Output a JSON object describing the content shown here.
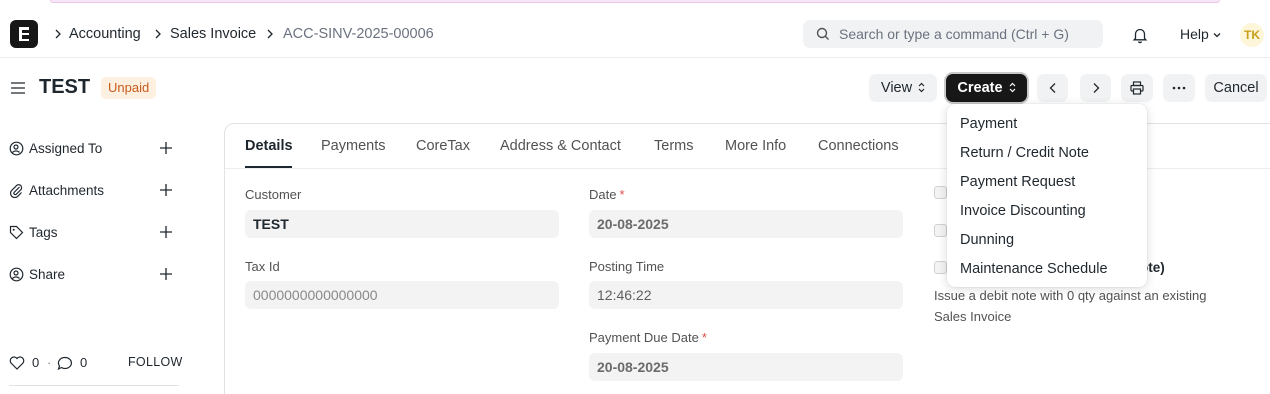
{
  "navbar": {
    "breadcrumbs": [
      "Accounting",
      "Sales Invoice",
      "ACC-SINV-2025-00006"
    ],
    "search_placeholder": "Search or type a command (Ctrl + G)",
    "help_label": "Help",
    "avatar_initials": "TK"
  },
  "page": {
    "title": "TEST",
    "status": "Unpaid"
  },
  "actions": {
    "view_label": "View",
    "create_label": "Create",
    "cancel_label": "Cancel"
  },
  "create_menu": [
    "Payment",
    "Return / Credit Note",
    "Payment Request",
    "Invoice Discounting",
    "Dunning",
    "Maintenance Schedule"
  ],
  "sidebar": {
    "items": [
      {
        "label": "Assigned To",
        "icon": "assign-icon"
      },
      {
        "label": "Attachments",
        "icon": "paperclip-icon"
      },
      {
        "label": "Tags",
        "icon": "tag-icon"
      },
      {
        "label": "Share",
        "icon": "share-icon"
      }
    ],
    "likes": "0",
    "comments": "0",
    "follow_label": "FOLLOW"
  },
  "tabs": [
    "Details",
    "Payments",
    "CoreTax",
    "Address & Contact",
    "Terms",
    "More Info",
    "Connections"
  ],
  "form": {
    "customer_label": "Customer",
    "customer_value": "TEST",
    "tax_id_label": "Tax Id",
    "tax_id_value": "0000000000000000",
    "date_label": "Date",
    "date_value": "20-08-2025",
    "posting_time_label": "Posting Time",
    "posting_time_value": "12:46:22",
    "due_date_label": "Payment Due Date",
    "due_date_value": "20-08-2025",
    "required_mark": "*",
    "partial_label_tail": "t Note)",
    "debit_note_desc": "Issue a debit note with 0 qty against an existing Sales Invoice"
  }
}
